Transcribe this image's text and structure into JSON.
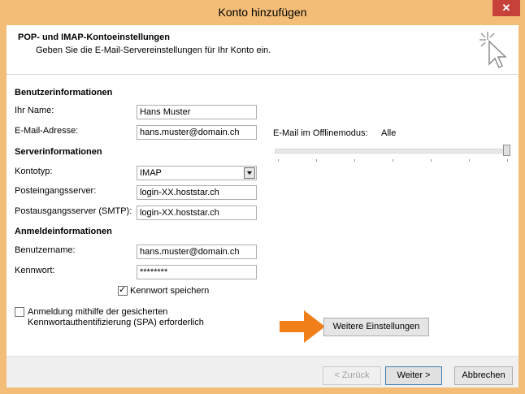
{
  "window": {
    "title": "Konto hinzufügen",
    "close_label": "✕"
  },
  "header": {
    "title": "POP- und IMAP-Kontoeinstellungen",
    "subtitle": "Geben Sie die E-Mail-Servereinstellungen für Ihr Konto ein."
  },
  "user_info": {
    "heading": "Benutzerinformationen",
    "name_label": "Ihr Name:",
    "name_value": "Hans Muster",
    "email_label": "E-Mail-Adresse:",
    "email_value": "hans.muster@domain.ch"
  },
  "server_info": {
    "heading": "Serverinformationen",
    "account_type_label": "Kontotyp:",
    "account_type_value": "IMAP",
    "incoming_label": "Posteingangsserver:",
    "incoming_value": "login-XX.hoststar.ch",
    "outgoing_label": "Postausgangsserver (SMTP):",
    "outgoing_value": "login-XX.hoststar.ch"
  },
  "login_info": {
    "heading": "Anmeldeinformationen",
    "username_label": "Benutzername:",
    "username_value": "hans.muster@domain.ch",
    "password_label": "Kennwort:",
    "password_value": "********",
    "remember_label": "Kennwort speichern",
    "remember_checked": true,
    "spa_label_line1": "Anmeldung mithilfe der gesicherten",
    "spa_label_line2": "Kennwortauthentifizierung (SPA) erforderlich",
    "spa_checked": false
  },
  "offline": {
    "label": "E-Mail im Offlinemodus:",
    "value": "Alle",
    "slider_level": 1.0
  },
  "buttons": {
    "more_settings": "Weitere Einstellungen",
    "back": "< Zurück",
    "next": "Weiter >",
    "cancel": "Abbrechen"
  },
  "colors": {
    "titlebar": "#f3bd77",
    "close": "#c6413a",
    "arrow": "#f07f1a"
  },
  "icons": {
    "wizard": "cursor-sparkle-icon",
    "pointer": "orange-arrow-icon"
  }
}
